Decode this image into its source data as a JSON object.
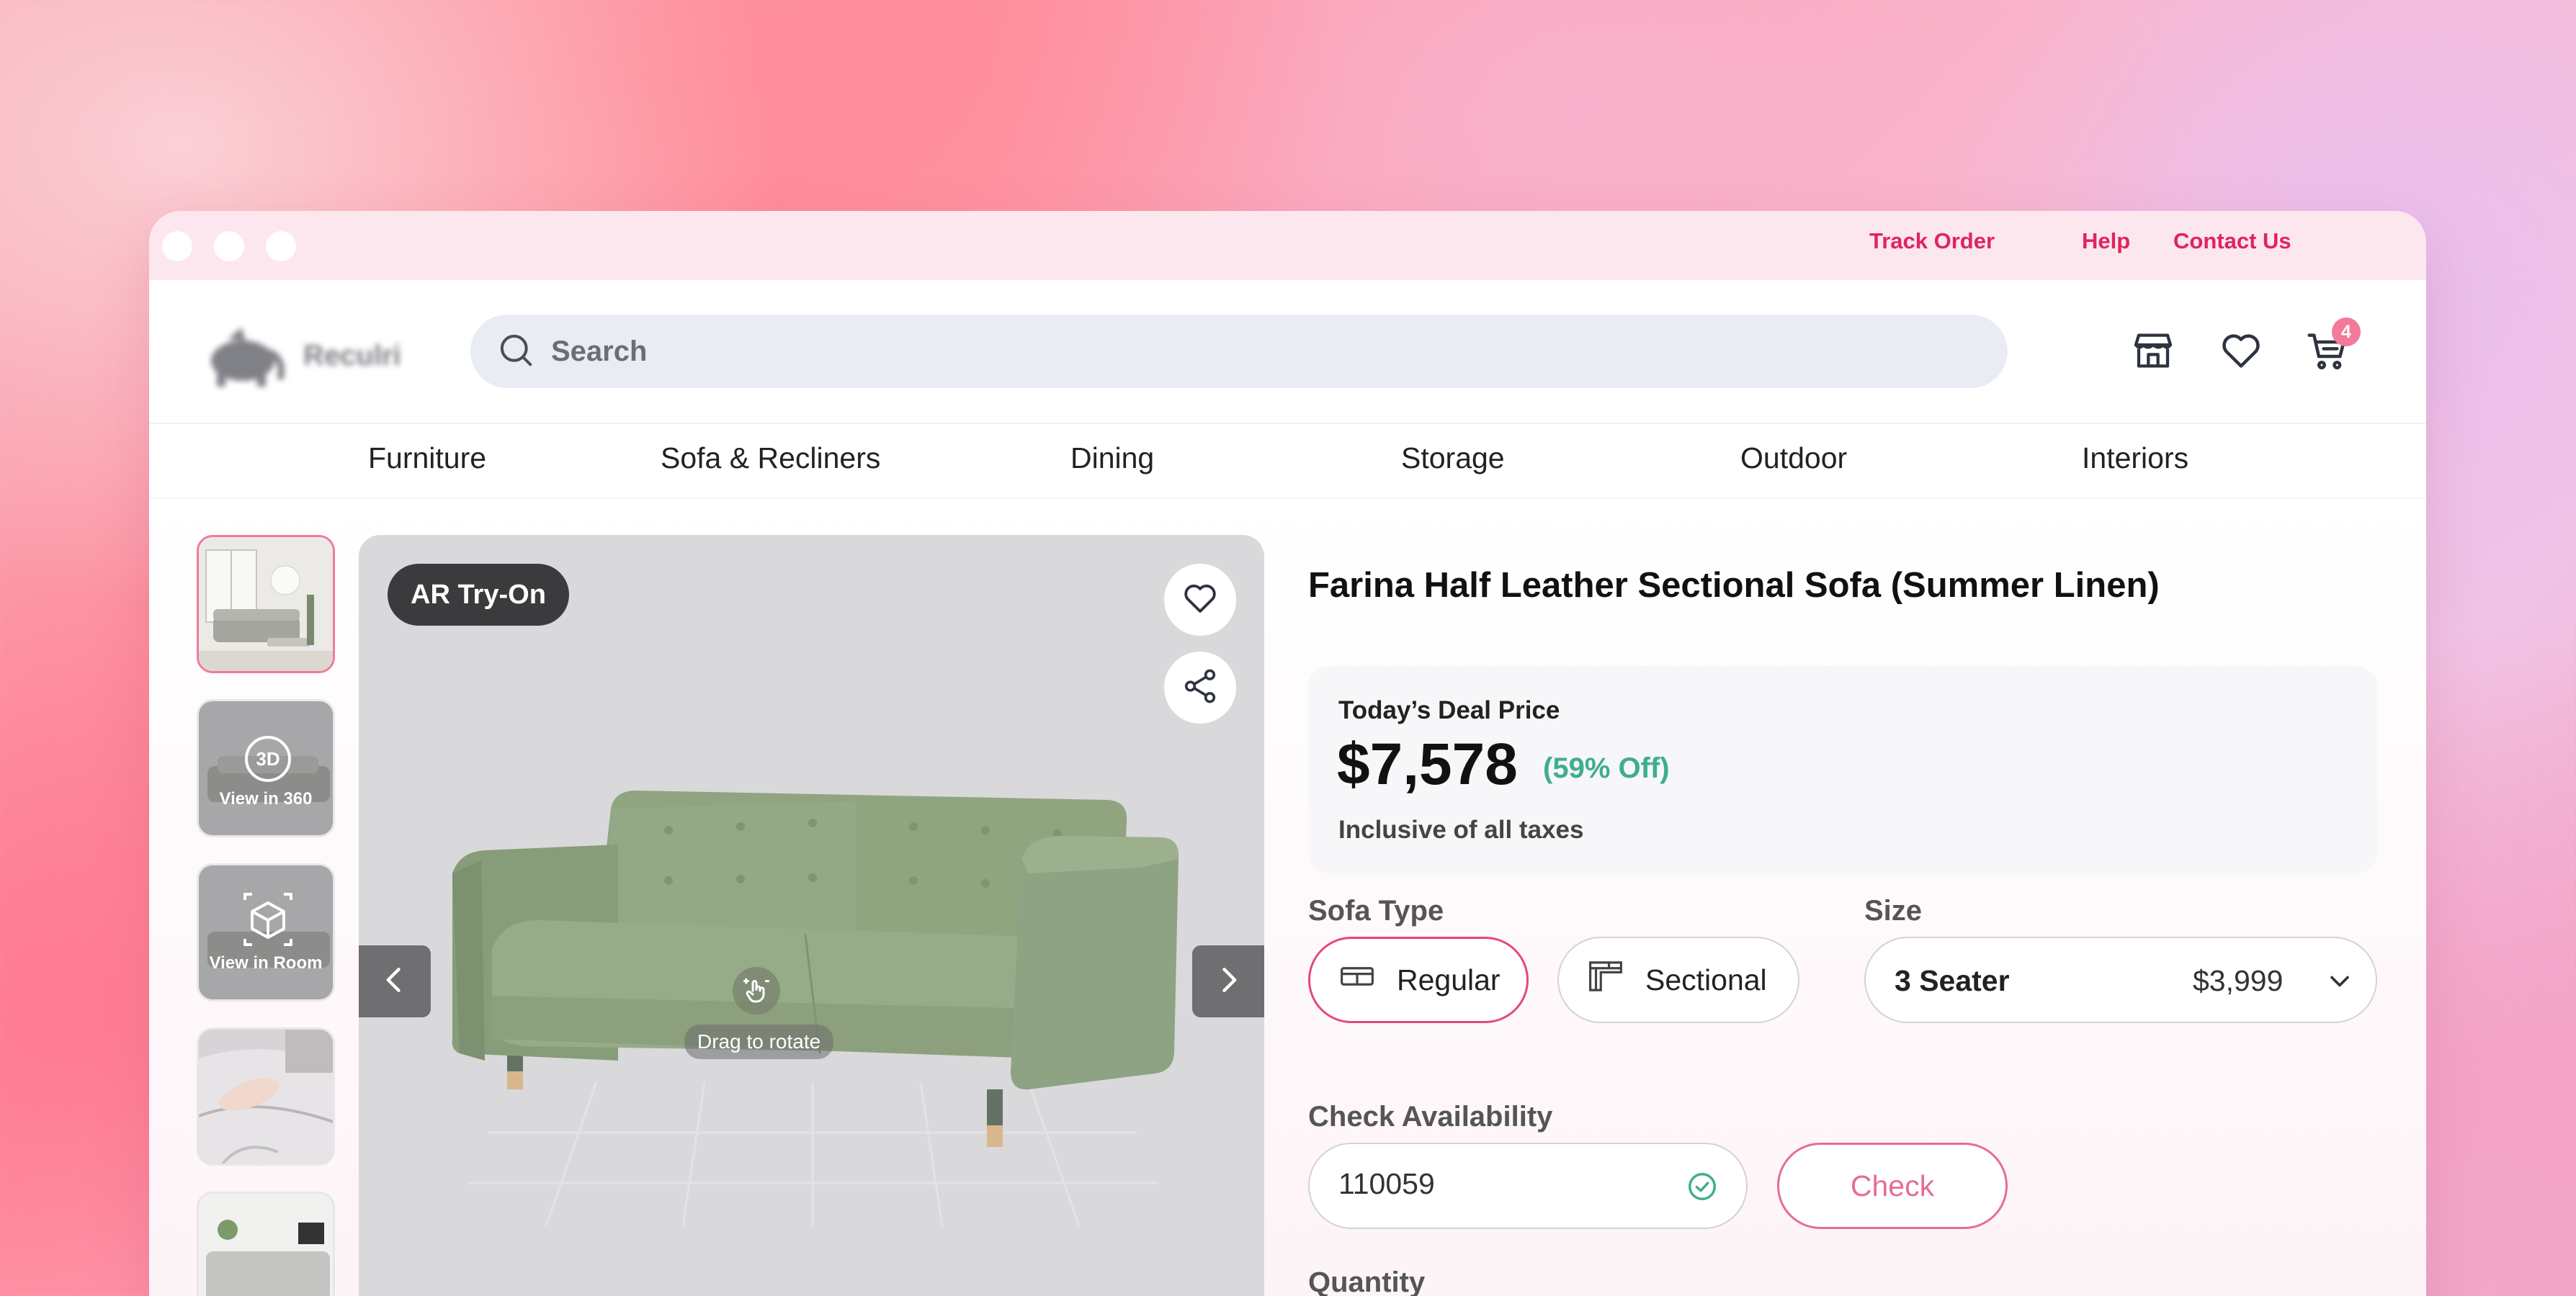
{
  "top_links": {
    "track_order": "Track Order",
    "help": "Help",
    "contact_us": "Contact Us"
  },
  "brand": {
    "name": "Reculri"
  },
  "search": {
    "placeholder": "Search"
  },
  "header_icons": {
    "store": "store-icon",
    "wishlist": "heart-icon",
    "cart": "cart-icon",
    "cart_count": "4"
  },
  "nav": [
    "Furniture",
    "Sofa & Recliners",
    "Dining",
    "Storage",
    "Outdoor",
    "Interiors"
  ],
  "gallery": {
    "thumbs": [
      {
        "kind": "photo",
        "label": ""
      },
      {
        "kind": "360",
        "label": "View in 360"
      },
      {
        "kind": "room",
        "label": "View in Room"
      },
      {
        "kind": "photo",
        "label": ""
      },
      {
        "kind": "photo",
        "label": ""
      }
    ],
    "ar_label": "AR Try-On",
    "rotate_hint": "Drag to rotate"
  },
  "product": {
    "title": "Farina Half Leather Sectional Sofa (Summer Linen)",
    "deal_label": "Today’s Deal Price",
    "price": "$7,578",
    "discount": "(59% Off)",
    "tax_note": "Inclusive of all taxes"
  },
  "sofa_type": {
    "label": "Sofa Type",
    "options": [
      "Regular",
      "Sectional"
    ],
    "selected": "Regular"
  },
  "size": {
    "label": "Size",
    "value": "3 Seater",
    "price": "$3,999"
  },
  "availability": {
    "label": "Check Availability",
    "pincode": "110059",
    "button": "Check"
  },
  "quantity": {
    "label": "Quantity"
  },
  "colors": {
    "accent": "#e0245e",
    "discount_green": "#3fae8c",
    "badge": "#f47a99"
  }
}
